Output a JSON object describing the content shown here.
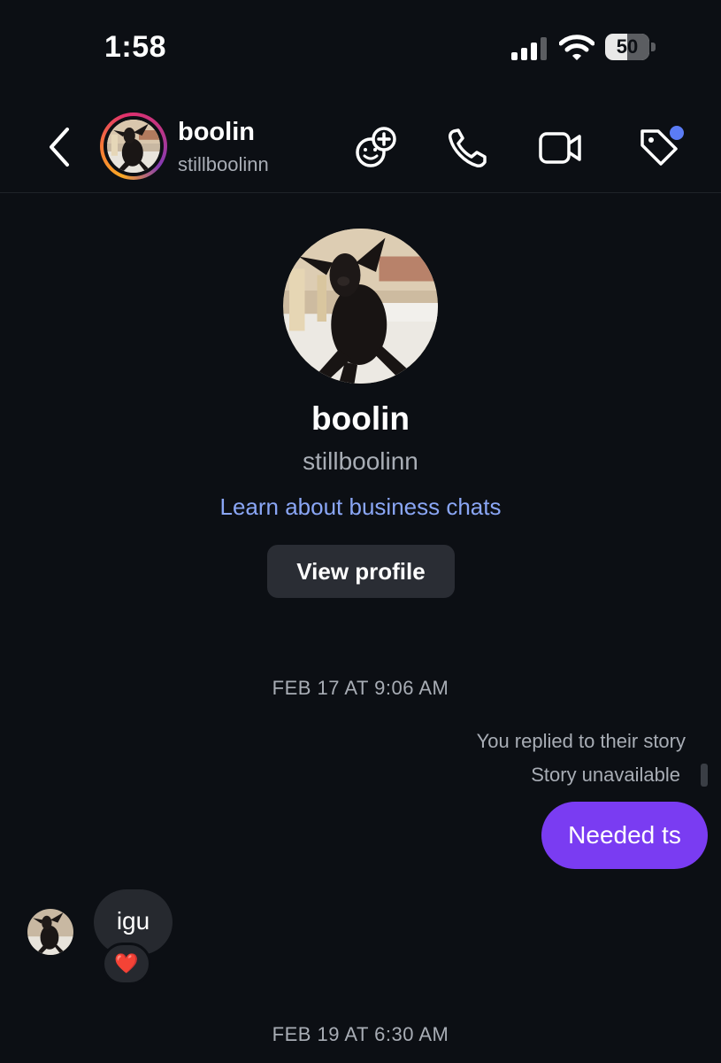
{
  "status_bar": {
    "time": "1:58",
    "battery_level": "50"
  },
  "header": {
    "name": "boolin",
    "username": "stillboolinn",
    "icons": [
      "back-chevron-icon",
      "add-emoji-sticker-icon",
      "phone-icon",
      "video-camera-icon",
      "tag-icon"
    ],
    "notification_dot_color": "#5b7cf5"
  },
  "profile": {
    "name": "boolin",
    "username": "stillboolinn",
    "business_link": "Learn about business chats",
    "view_profile_label": "View profile"
  },
  "conversation": {
    "timestamp_1": "FEB 17 AT 9:06 AM",
    "story_replied": "You replied to their story",
    "story_status": "Story unavailable",
    "sent_message": "Needed ts",
    "received_message": "igu",
    "reaction": "❤️",
    "timestamp_2": "FEB 19 AT 6:30 AM"
  },
  "colors": {
    "background": "#0c0f14",
    "sent_bubble": "#7a3cf2",
    "received_bubble": "#26292f",
    "link": "#8aa6f5"
  }
}
